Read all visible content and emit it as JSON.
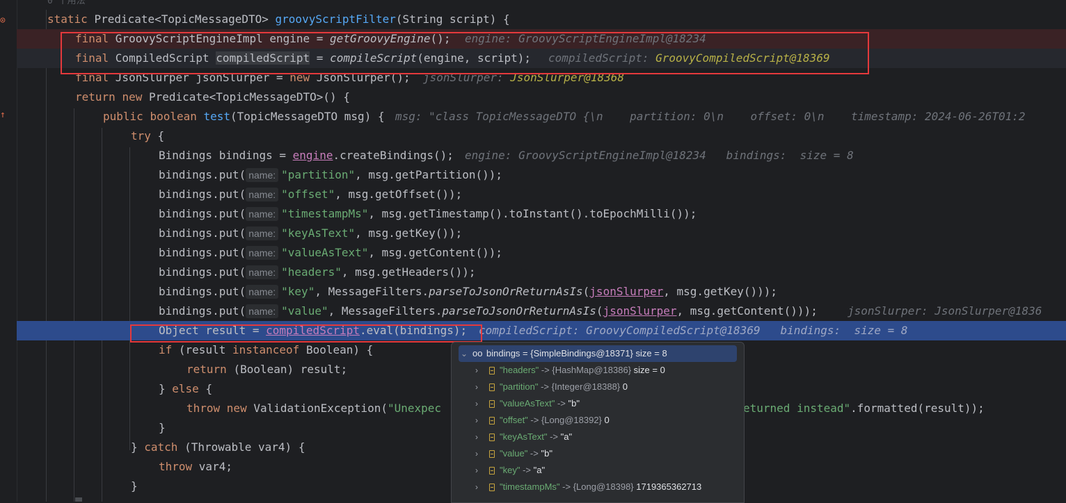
{
  "header_hint": "0 个用法",
  "lines": [
    {
      "id": "sig",
      "tokens": [
        [
          "static ",
          "kw"
        ],
        [
          "Predicate<TopicMessageDTO> ",
          ""
        ],
        [
          "groovyScriptFilter",
          "fn"
        ],
        [
          "(String script) {",
          ""
        ]
      ]
    },
    {
      "id": "l_engine",
      "tokens": [
        [
          "final ",
          "kw"
        ],
        [
          "GroovyScriptEngineImpl engine = ",
          ""
        ],
        [
          "getGroovyEngine",
          "it"
        ],
        [
          "();",
          ""
        ]
      ],
      "dbg": "engine: GroovyScriptEngineImpl@18234"
    },
    {
      "id": "l_compiled",
      "tokens": [
        [
          "final ",
          "kw"
        ],
        [
          "CompiledScript ",
          ""
        ],
        [
          "compiledScript",
          "hl"
        ],
        [
          " = ",
          ""
        ],
        [
          "compileScript",
          "it"
        ],
        [
          "(engine, script);",
          ""
        ]
      ],
      "dbg": "compiledScript: ",
      "dbgv": "GroovyCompiledScript@18369"
    },
    {
      "id": "l_slurper",
      "tokens": [
        [
          "final ",
          "kw"
        ],
        [
          "JsonSlurper jsonSlurper = ",
          ""
        ],
        [
          "new ",
          "kw"
        ],
        [
          "JsonSlurper();",
          ""
        ]
      ],
      "dbg": "jsonSlurper: ",
      "dbgv": "JsonSlurper@18368"
    },
    {
      "id": "l_return",
      "tokens": [
        [
          "return ",
          "kw"
        ],
        [
          "new ",
          "kw"
        ],
        [
          "Predicate<TopicMessageDTO>() {",
          ""
        ]
      ]
    },
    {
      "id": "l_test",
      "tokens": [
        [
          "public ",
          "kw"
        ],
        [
          "boolean ",
          "kw"
        ],
        [
          "test",
          "fn"
        ],
        [
          "(TopicMessageDTO msg) {",
          ""
        ]
      ],
      "dbg": "msg: \"class TopicMessageDTO {\\n    partition: 0\\n    offset: 0\\n    timestamp: 2024-06-26T01:2"
    },
    {
      "id": "l_try",
      "tokens": [
        [
          "try ",
          "kw"
        ],
        [
          "{",
          ""
        ]
      ]
    },
    {
      "id": "l_bindings",
      "tokens": [
        [
          "Bindings bindings = ",
          ""
        ],
        [
          "engine",
          "fld"
        ],
        [
          ".createBindings();",
          ""
        ]
      ],
      "dbg": "engine: GroovyScriptEngineImpl@18234   bindings:  size = 8"
    },
    {
      "id": "l_put1",
      "tokens": [
        [
          "bindings.put(",
          ""
        ],
        [
          "name:",
          "hint"
        ],
        [
          "\"partition\"",
          "str"
        ],
        [
          ", msg.getPartition());",
          ""
        ]
      ]
    },
    {
      "id": "l_put2",
      "tokens": [
        [
          "bindings.put(",
          ""
        ],
        [
          "name:",
          "hint"
        ],
        [
          "\"offset\"",
          "str"
        ],
        [
          ", msg.getOffset());",
          ""
        ]
      ]
    },
    {
      "id": "l_put3",
      "tokens": [
        [
          "bindings.put(",
          ""
        ],
        [
          "name:",
          "hint"
        ],
        [
          "\"timestampMs\"",
          "str"
        ],
        [
          ", msg.getTimestamp().toInstant().toEpochMilli());",
          ""
        ]
      ]
    },
    {
      "id": "l_put4",
      "tokens": [
        [
          "bindings.put(",
          ""
        ],
        [
          "name:",
          "hint"
        ],
        [
          "\"keyAsText\"",
          "str"
        ],
        [
          ", msg.getKey());",
          ""
        ]
      ]
    },
    {
      "id": "l_put5",
      "tokens": [
        [
          "bindings.put(",
          ""
        ],
        [
          "name:",
          "hint"
        ],
        [
          "\"valueAsText\"",
          "str"
        ],
        [
          ", msg.getContent());",
          ""
        ]
      ]
    },
    {
      "id": "l_put6",
      "tokens": [
        [
          "bindings.put(",
          ""
        ],
        [
          "name:",
          "hint"
        ],
        [
          "\"headers\"",
          "str"
        ],
        [
          ", msg.getHeaders());",
          ""
        ]
      ]
    },
    {
      "id": "l_put7",
      "tokens": [
        [
          "bindings.put(",
          ""
        ],
        [
          "name:",
          "hint"
        ],
        [
          "\"key\"",
          "str"
        ],
        [
          ", MessageFilters.",
          ""
        ],
        [
          "parseToJsonOrReturnAsIs",
          "it"
        ],
        [
          "(",
          ""
        ],
        [
          "jsonSlurper",
          "fld"
        ],
        [
          ", msg.getKey()));",
          ""
        ]
      ]
    },
    {
      "id": "l_put8",
      "tokens": [
        [
          "bindings.put(",
          ""
        ],
        [
          "name:",
          "hint"
        ],
        [
          "\"value\"",
          "str"
        ],
        [
          ", MessageFilters.",
          ""
        ],
        [
          "parseToJsonOrReturnAsIs",
          "it"
        ],
        [
          "(",
          ""
        ],
        [
          "jsonSlurper",
          "fld"
        ],
        [
          ", msg.getContent()));",
          ""
        ]
      ],
      "dbg": "jsonSlurper: JsonSlurper@1836"
    },
    {
      "id": "l_eval",
      "tokens": [
        [
          "Object result = ",
          ""
        ],
        [
          "compiledScript",
          "fld"
        ],
        [
          ".eval(bindings);",
          ""
        ]
      ],
      "dbg": "compiledScript: GroovyCompiledScript@18369   bindings:  size = 8"
    },
    {
      "id": "l_if",
      "tokens": [
        [
          "if ",
          "kw"
        ],
        [
          "(result ",
          ""
        ],
        [
          "instanceof ",
          "kw"
        ],
        [
          "Boolean) {",
          ""
        ]
      ]
    },
    {
      "id": "l_ret_bool",
      "tokens": [
        [
          "return ",
          "kw"
        ],
        [
          "(Boolean) result;",
          ""
        ]
      ]
    },
    {
      "id": "l_else",
      "tokens": [
        [
          "} ",
          ""
        ],
        [
          "else ",
          "kw"
        ],
        [
          "{",
          ""
        ]
      ]
    },
    {
      "id": "l_throw1",
      "tokens": [
        [
          "throw ",
          "kw"
        ],
        [
          "new ",
          "kw"
        ],
        [
          "ValidationException(",
          ""
        ],
        [
          "\"Unexpec",
          "str"
        ]
      ],
      "tail": [
        [
          "eturned instead\"",
          "str"
        ],
        [
          ".formatted(result));",
          ""
        ]
      ]
    },
    {
      "id": "l_close1",
      "tokens": [
        [
          "}",
          ""
        ]
      ]
    },
    {
      "id": "l_catch",
      "tokens": [
        [
          "} ",
          ""
        ],
        [
          "catch ",
          "kw"
        ],
        [
          "(Throwable var4) {",
          ""
        ]
      ]
    },
    {
      "id": "l_throw2",
      "tokens": [
        [
          "throw ",
          "kw"
        ],
        [
          "var4;",
          ""
        ]
      ]
    },
    {
      "id": "l_close2",
      "tokens": [
        [
          "}",
          ""
        ]
      ]
    }
  ],
  "popup": {
    "root": {
      "name": "bindings",
      "eq": " = ",
      "type": "{SimpleBindings@18371}",
      "extra": "  size = 8"
    },
    "entries": [
      {
        "key": "\"headers\"",
        "arrow": " -> ",
        "type": "{HashMap@18386}",
        "value": "  size = 0"
      },
      {
        "key": "\"partition\"",
        "arrow": " -> ",
        "type": "{Integer@18388}",
        "value": " 0"
      },
      {
        "key": "\"valueAsText\"",
        "arrow": " -> ",
        "type": "",
        "value": "\"b\""
      },
      {
        "key": "\"offset\"",
        "arrow": " -> ",
        "type": "{Long@18392}",
        "value": " 0"
      },
      {
        "key": "\"keyAsText\"",
        "arrow": " -> ",
        "type": "",
        "value": "\"a\""
      },
      {
        "key": "\"value\"",
        "arrow": " -> ",
        "type": "",
        "value": "\"b\""
      },
      {
        "key": "\"key\"",
        "arrow": " -> ",
        "type": "",
        "value": "\"a\""
      },
      {
        "key": "\"timestampMs\"",
        "arrow": " -> ",
        "type": "{Long@18398}",
        "value": " 1719365362713"
      }
    ]
  },
  "colors": {
    "exec_line": "#2d4b8c",
    "breakpoint_line": "#3a2225",
    "highlight_box": "#e5393c"
  }
}
